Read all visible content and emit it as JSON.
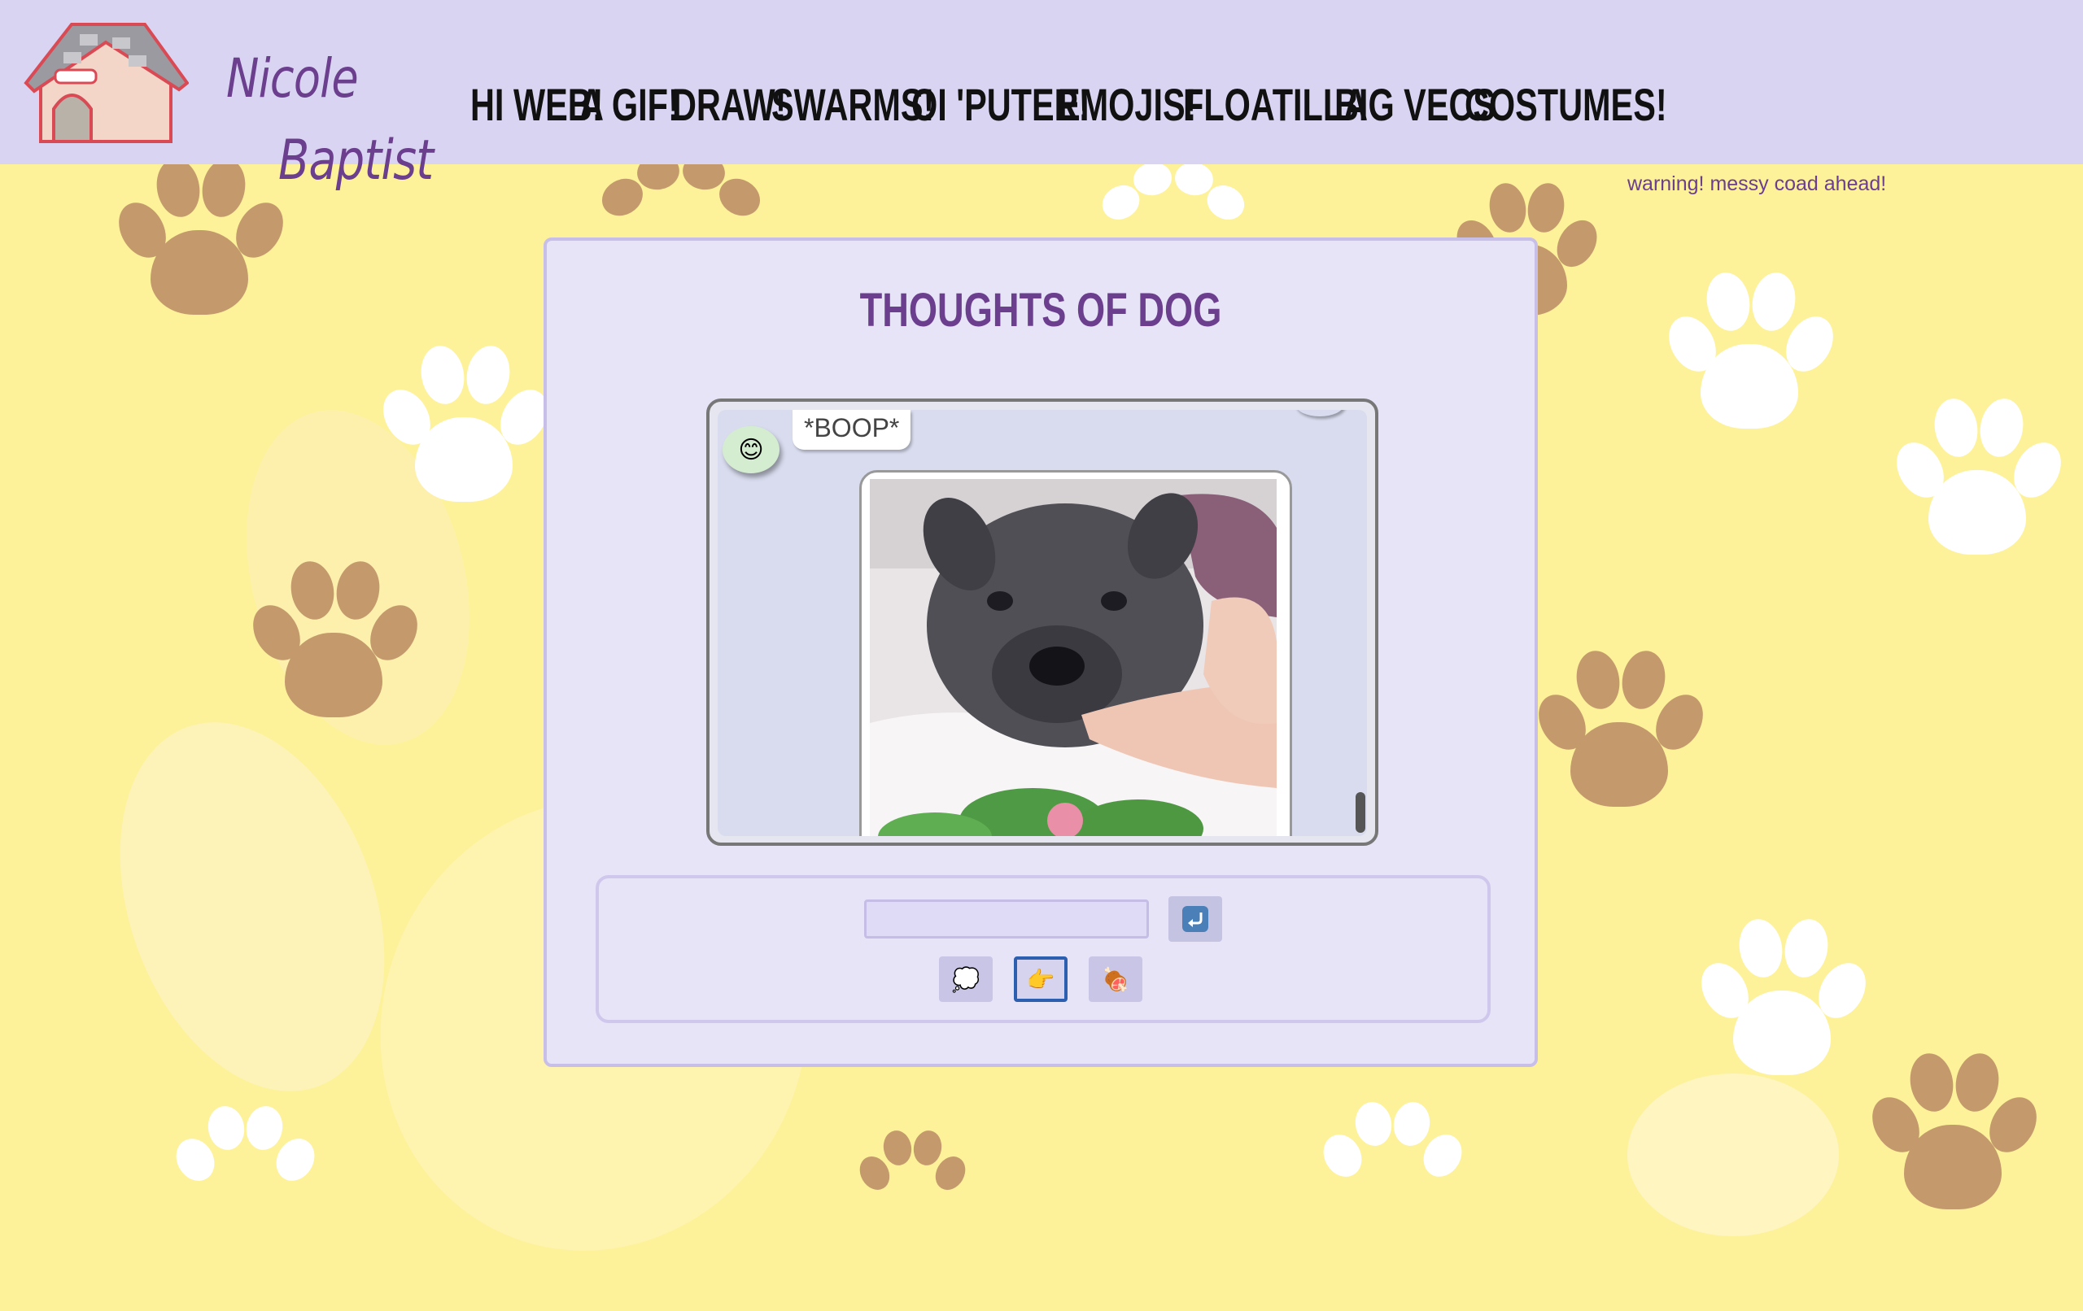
{
  "site": {
    "brand_first": "Nicole",
    "brand_last": "Baptist",
    "logo_icon": "dog-house-icon"
  },
  "nav": {
    "items": [
      {
        "label": "HI WEB!"
      },
      {
        "label": "A GIF!"
      },
      {
        "label": "DRAW!"
      },
      {
        "label": "SWARMS!"
      },
      {
        "label": "OI 'PUTER!"
      },
      {
        "label": "EMOJIS!"
      },
      {
        "label": "FLOATILLA"
      },
      {
        "label": "BIG VECS"
      },
      {
        "label": "COSTUMES!"
      }
    ]
  },
  "warning": "warning! messy coad ahead!",
  "main": {
    "title": "THOUGHTS OF DOG",
    "chat": {
      "avatar_emoji": "😊",
      "bubble_text": "*BOOP*",
      "gif_subject": "dog-boop-gif"
    },
    "controls": {
      "input_value": "",
      "send_icon": "return-arrow-icon",
      "actions": [
        {
          "name": "thought-bubble-button",
          "glyph": "💭",
          "selected": false
        },
        {
          "name": "point-button",
          "glyph": "👉",
          "selected": true
        },
        {
          "name": "meat-button",
          "glyph": "🍖",
          "selected": false
        }
      ]
    }
  },
  "colors": {
    "background": "#fdf29a",
    "header": "#d9d4f2",
    "accent_purple": "#6b3e8e",
    "card": "#e8e4f8",
    "paw_brown": "#c49a6c",
    "paw_white": "#ffffff",
    "selected_border": "#2d5fb0"
  }
}
